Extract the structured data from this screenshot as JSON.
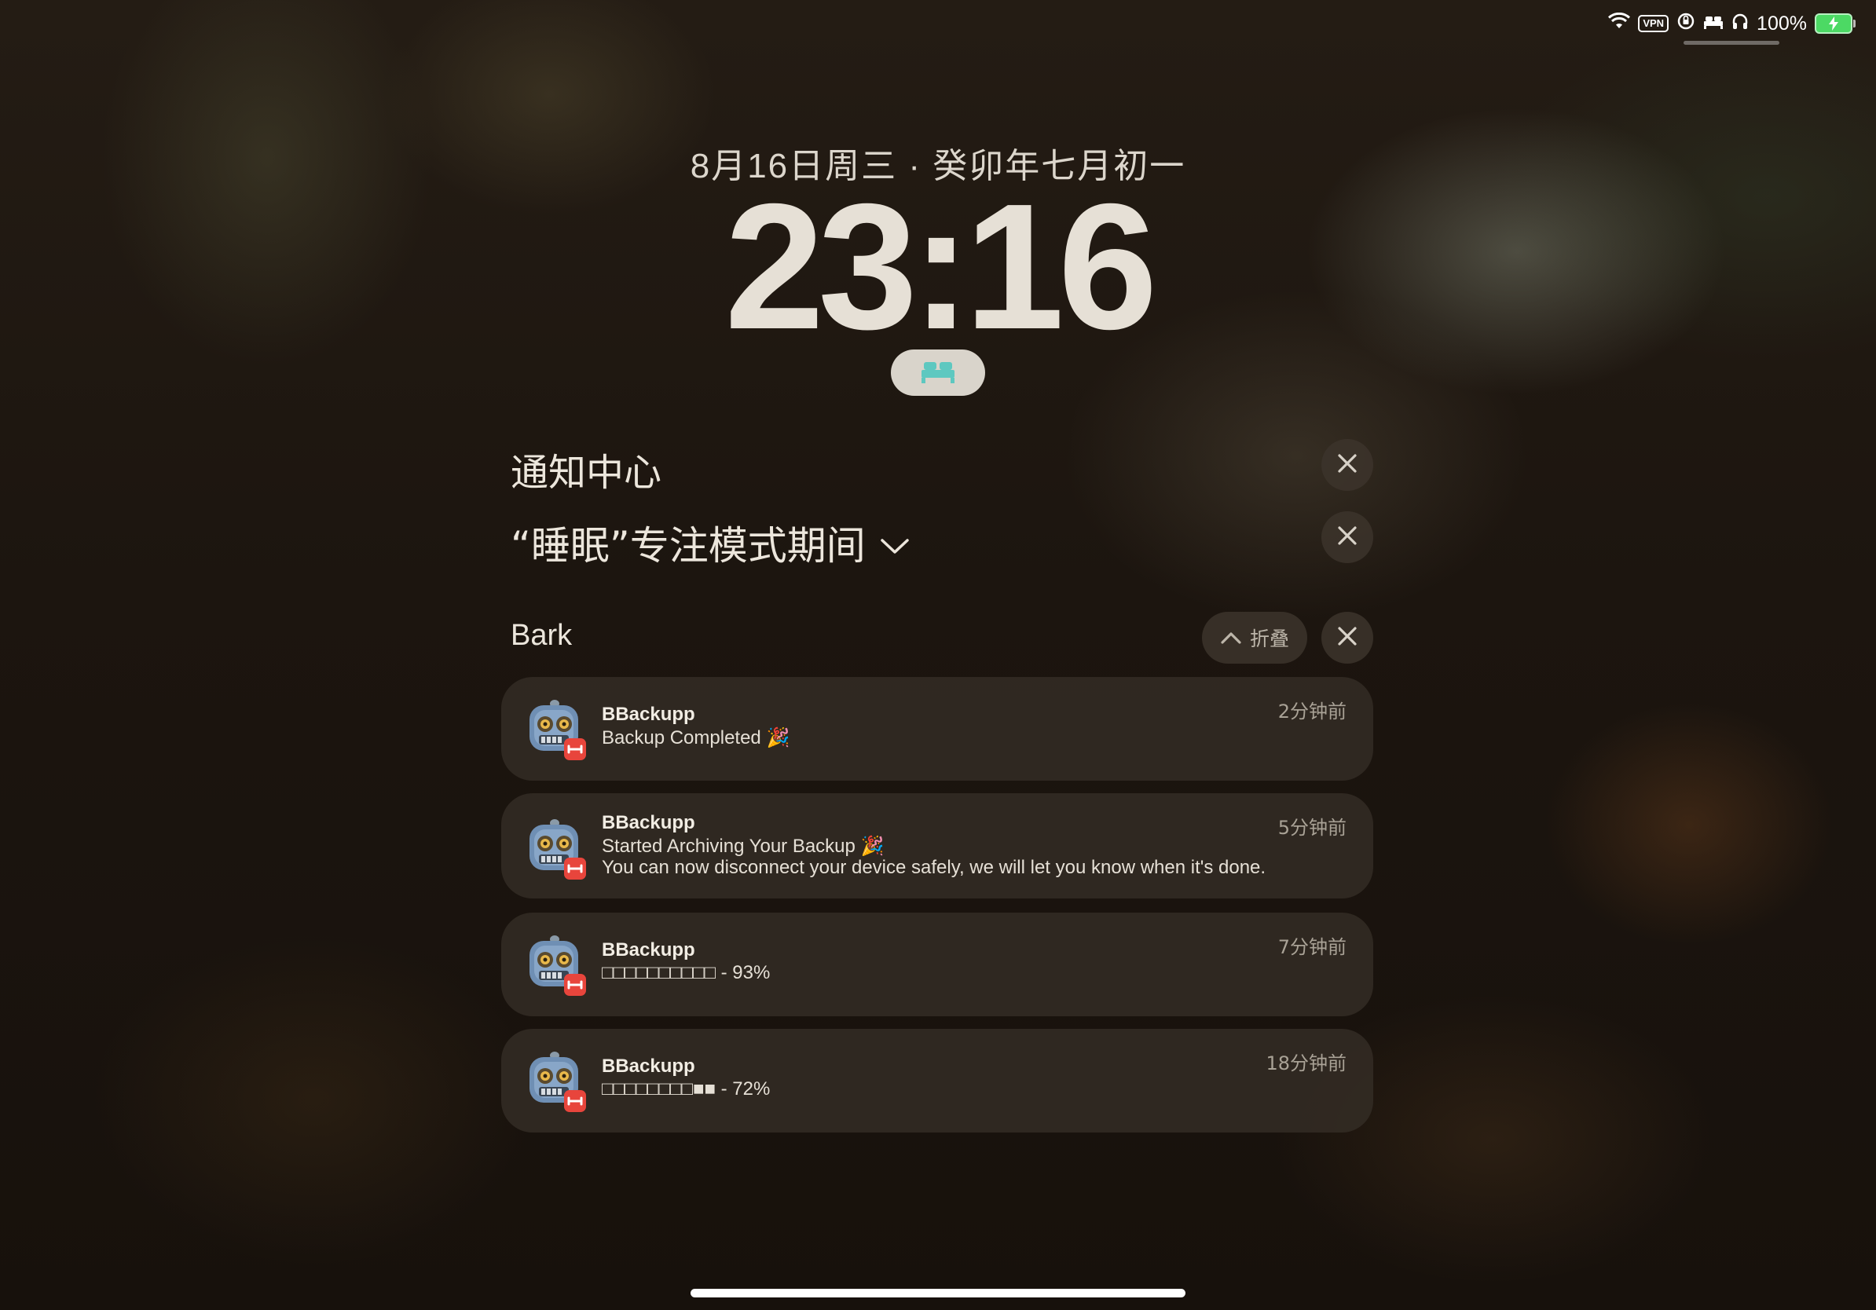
{
  "status_bar": {
    "wifi_icon": "wifi-icon",
    "vpn_label": "VPN",
    "battery_percent": "100%",
    "battery_level": 1.0,
    "battery_color": "#4cd964"
  },
  "lock_screen": {
    "date": "8月16日周三 · 癸卯年七月初一",
    "time": "23:16",
    "focus_pill_icon": "bed-icon",
    "focus_accent": "#5ec8c0"
  },
  "notification_center": {
    "title": "通知中心",
    "focus_mode_label": "“睡眠”专注模式期间",
    "group": {
      "app_name": "Bark",
      "collapse_label": "折叠"
    },
    "notifications": [
      {
        "app": "BBackupp",
        "line1": "Backup Completed 🎉",
        "line2": "",
        "time": "2分钟前"
      },
      {
        "app": "BBackupp",
        "line1": "Started Archiving Your Backup 🎉",
        "line2": "You can now disconnect your device safely, we will let you know when it's done.",
        "time": "5分钟前"
      },
      {
        "app": "BBackupp",
        "line1": "□□□□□□□□□□ - 93%",
        "line2": "",
        "time": "7分钟前"
      },
      {
        "app": "BBackupp",
        "line1": "□□□□□□□□■■ - 72%",
        "line2": "",
        "time": "18分钟前"
      }
    ]
  }
}
